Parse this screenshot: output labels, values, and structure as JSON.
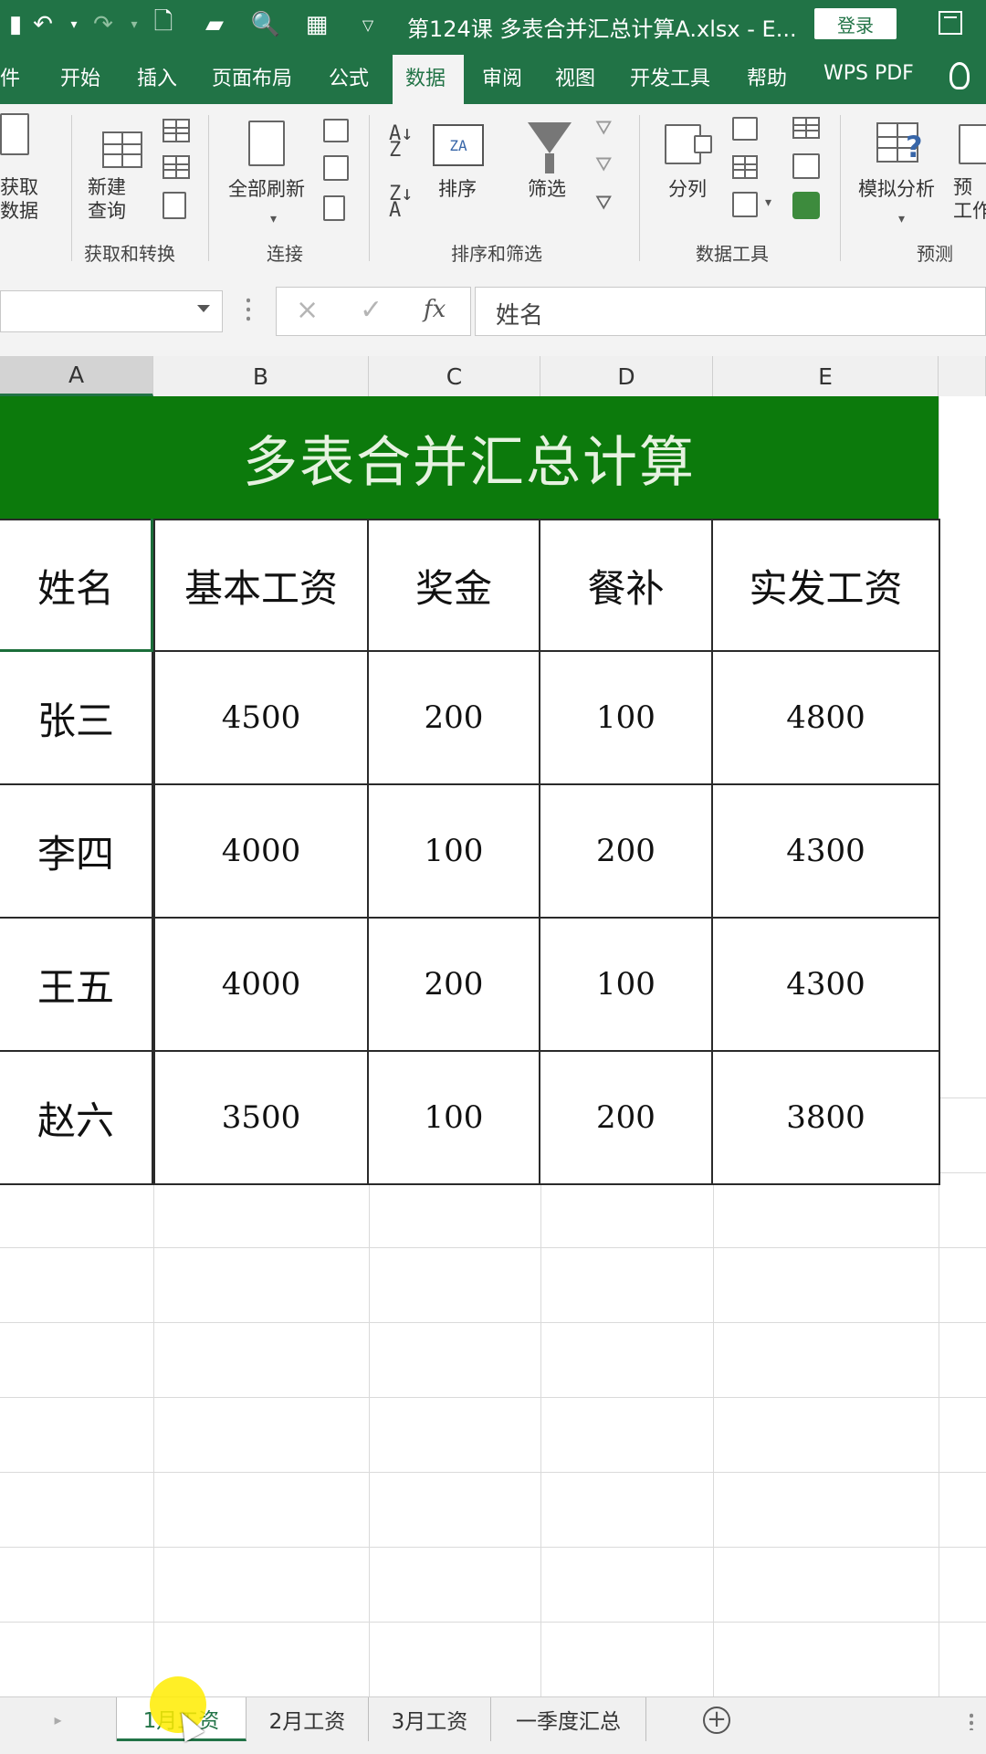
{
  "title_bar": {
    "title": "第124课 多表合并汇总计算A.xlsx - E...",
    "login_label": "登录",
    "quick_access_icons": [
      "save-icon",
      "undo-icon",
      "redo-icon",
      "new-file-icon",
      "open-folder-icon",
      "print-preview-icon",
      "calculator-icon",
      "customize-icon"
    ]
  },
  "ribbon_tabs": [
    "件",
    "开始",
    "插入",
    "页面布局",
    "公式",
    "数据",
    "审阅",
    "视图",
    "开发工具",
    "帮助",
    "WPS PDF"
  ],
  "active_tab": "数据",
  "ribbon": {
    "get_data": "获取\n数据",
    "new_query": "新建\n查询",
    "refresh_all": "全部刷新",
    "sort": "排序",
    "filter": "筛选",
    "text_to_columns": "分列",
    "what_if": "模拟分析",
    "forecast": "预\n工作",
    "groups": {
      "get_transform": "获取和转换",
      "connections": "连接",
      "sort_filter": "排序和筛选",
      "data_tools": "数据工具",
      "forecast": "预测"
    }
  },
  "formula_bar": {
    "name_box": "",
    "cancel_symbol": "×",
    "enter_symbol": "✓",
    "fx_label": "fx",
    "content": "姓名"
  },
  "columns": [
    "A",
    "B",
    "C",
    "D",
    "E"
  ],
  "selected_column": "A",
  "sheet": {
    "title": "多表合并汇总计算",
    "headers": [
      "姓名",
      "基本工资",
      "奖金",
      "餐补",
      "实发工资"
    ],
    "rows": [
      [
        "张三",
        "4500",
        "200",
        "100",
        "4800"
      ],
      [
        "李四",
        "4000",
        "100",
        "200",
        "4300"
      ],
      [
        "王五",
        "4000",
        "200",
        "100",
        "4300"
      ],
      [
        "赵六",
        "3500",
        "100",
        "200",
        "3800"
      ]
    ]
  },
  "sheet_tabs": [
    "1月工资",
    "2月工资",
    "3月工资",
    "一季度汇总"
  ],
  "active_sheet": "1月工资",
  "colors": {
    "excel_green": "#217346",
    "title_band": "#0c7a0c",
    "title_text": "#e6f2e0"
  }
}
